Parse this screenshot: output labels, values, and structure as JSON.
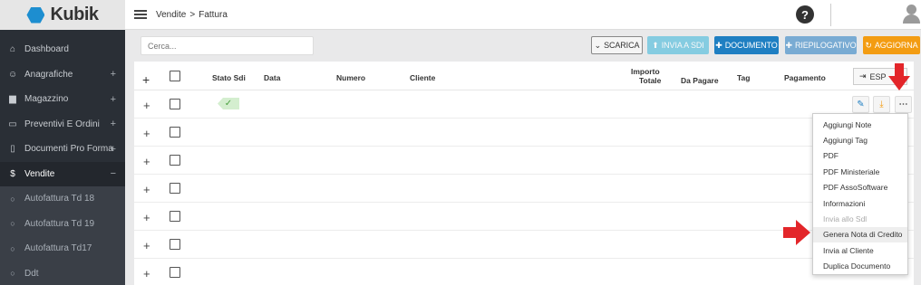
{
  "app": {
    "logo_text": "Kubik"
  },
  "breadcrumb": {
    "section": "Vendite",
    "separator": ">",
    "page": "Fattura"
  },
  "header": {
    "help_symbol": "?"
  },
  "sidebar": {
    "items": [
      {
        "label": "Dashboard",
        "icon": "home-icon",
        "expand": ""
      },
      {
        "label": "Anagrafiche",
        "icon": "user-icon",
        "expand": "+"
      },
      {
        "label": "Magazzino",
        "icon": "box-icon",
        "expand": "+"
      },
      {
        "label": "Preventivi E Ordini",
        "icon": "calendar-icon",
        "expand": "+"
      },
      {
        "label": "Documenti Pro Forma",
        "icon": "document-icon",
        "expand": "+"
      },
      {
        "label": "Vendite",
        "icon": "dollar-icon",
        "expand": "−"
      }
    ],
    "subitems": [
      {
        "label": "Autofattura Td 18"
      },
      {
        "label": "Autofattura Td 19"
      },
      {
        "label": "Autofattura Td17"
      },
      {
        "label": "Ddt"
      }
    ]
  },
  "toolbar": {
    "search_placeholder": "Cerca...",
    "scarica": "SCARICA",
    "invia_sdi": "INVIA A SDI",
    "documento": "DOCUMENTO",
    "riepilogativo": "RIEPILOGATIVO",
    "aggiorna": "AGGIORNA"
  },
  "table": {
    "add_symbol": "+",
    "columns": {
      "stato_sdi": "Stato Sdi",
      "data": "Data",
      "numero": "Numero",
      "cliente": "Cliente",
      "importo_line1": "Importo",
      "importo_line2": "Totale",
      "da_pagare": "Da Pagare",
      "tag": "Tag",
      "pagamento": "Pagamento"
    },
    "export_label": "ESP",
    "rows": [
      {
        "plus": "+",
        "sdi_status": "✓"
      },
      {
        "plus": "+"
      },
      {
        "plus": "+"
      },
      {
        "plus": "+"
      },
      {
        "plus": "+"
      },
      {
        "plus": "+"
      },
      {
        "plus": "+"
      }
    ]
  },
  "menu": {
    "items": [
      {
        "label": "Aggiungi Note",
        "disabled": false,
        "highlighted": false
      },
      {
        "label": "Aggiungi Tag",
        "disabled": false,
        "highlighted": false
      },
      {
        "label": "PDF",
        "disabled": false,
        "highlighted": false
      },
      {
        "label": "PDF Ministeriale",
        "disabled": false,
        "highlighted": false
      },
      {
        "label": "PDF AssoSoftware",
        "disabled": false,
        "highlighted": false
      },
      {
        "label": "Informazioni",
        "disabled": false,
        "highlighted": false
      },
      {
        "label": "Invia allo Sdl",
        "disabled": true,
        "highlighted": false
      },
      {
        "label": "Genera Nota di Credito",
        "disabled": false,
        "highlighted": true
      },
      {
        "label": "Invia al Cliente",
        "disabled": false,
        "highlighted": false
      },
      {
        "label": "Duplica Documento",
        "disabled": false,
        "highlighted": false
      }
    ]
  },
  "colors": {
    "sidebar_bg": "#2a2f36",
    "primary": "#1f7fc2",
    "info": "#5bc0de",
    "warning": "#f39c12",
    "annotation_arrow": "#e3262a",
    "sdi_ok": "#4aa03f"
  }
}
